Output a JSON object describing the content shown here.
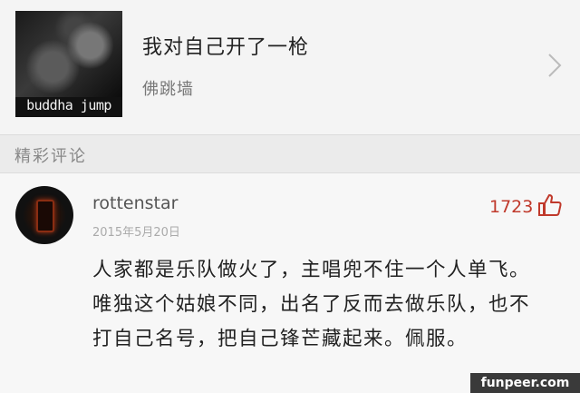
{
  "song": {
    "title": "我对自己开了一枪",
    "artist": "佛跳墙",
    "cover_text": "buddha jump"
  },
  "section": {
    "title": "精彩评论"
  },
  "comment": {
    "username": "rottenstar",
    "date": "2015年5月20日",
    "likes": "1723",
    "text": "人家都是乐队做火了，主唱兜不住一个人单飞。唯独这个姑娘不同，出名了反而去做乐队，也不打自己名号，把自己锋芒藏起来。佩服。"
  },
  "watermark": "funpeer.com",
  "colors": {
    "like_accent": "#c0392b",
    "background": "#f7f7f7"
  },
  "icons": [
    "chevron-right-icon",
    "thumbs-up-icon"
  ]
}
